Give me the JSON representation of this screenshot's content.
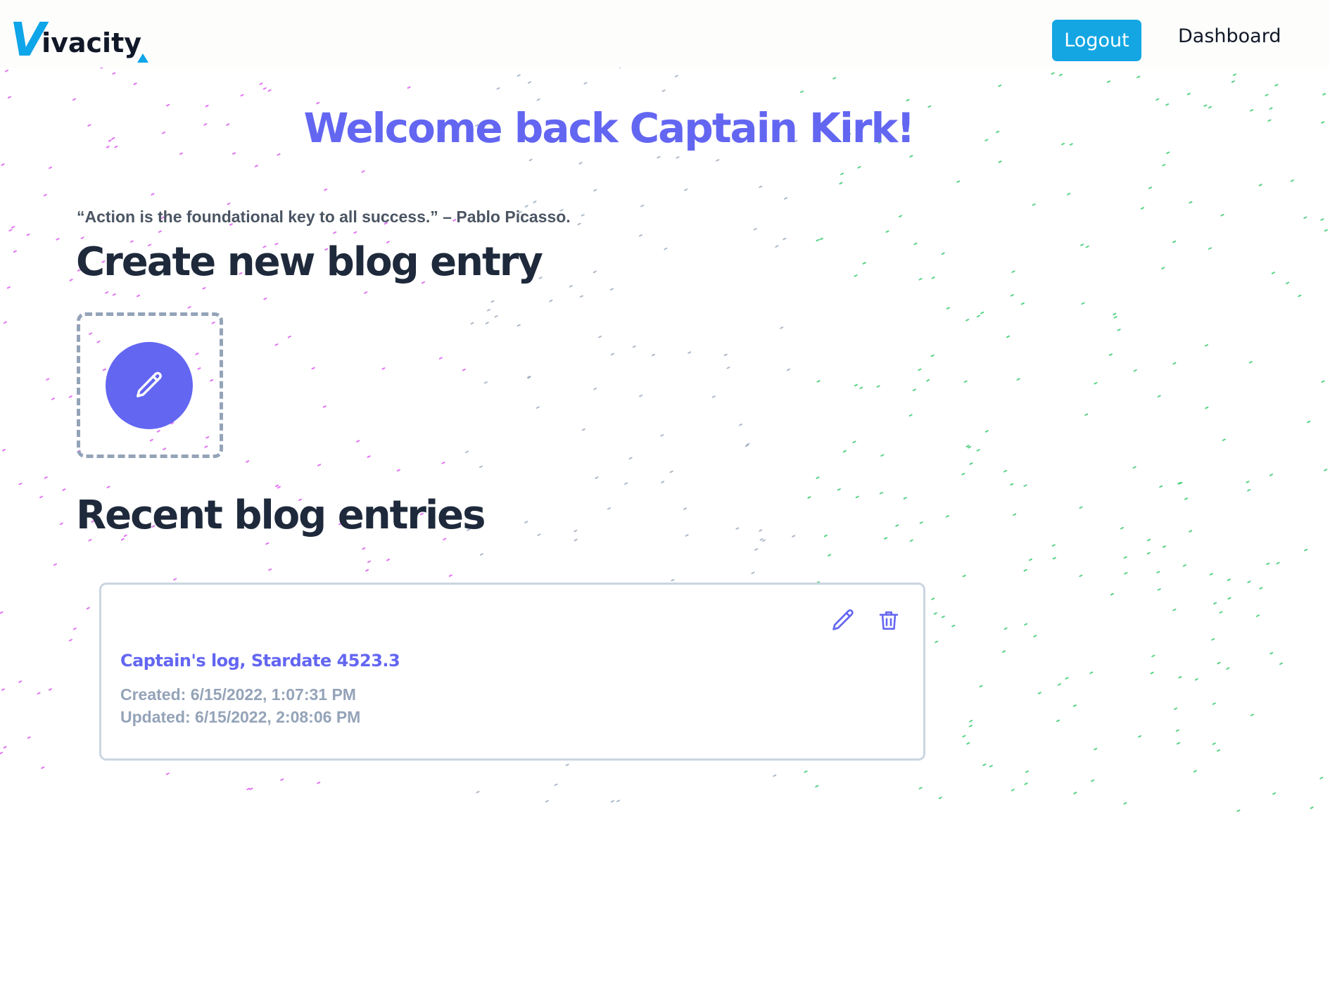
{
  "header": {
    "logo_letter": "V",
    "logo_rest": "ivacity",
    "logout_label": "Logout",
    "dashboard_label": "Dashboard"
  },
  "welcome": "Welcome back Captain Kirk!",
  "quote": "“Action is the foundational key to all success.” – Pablo Picasso.",
  "create_section": {
    "title": "Create new blog entry",
    "button_icon": "pencil-icon"
  },
  "recent_section": {
    "title": "Recent blog entries",
    "entries": [
      {
        "title": "Captain's log, Stardate 4523.3",
        "created": "Created: 6/15/2022, 1:07:31 PM",
        "updated": "Updated: 6/15/2022, 2:08:06 PM",
        "edit_icon": "pencil-icon",
        "delete_icon": "trash-icon"
      }
    ]
  },
  "colors": {
    "brand": "#0ea5e9",
    "accent": "#6366f1",
    "heading": "#1e293b",
    "muted": "#94a3b8"
  }
}
